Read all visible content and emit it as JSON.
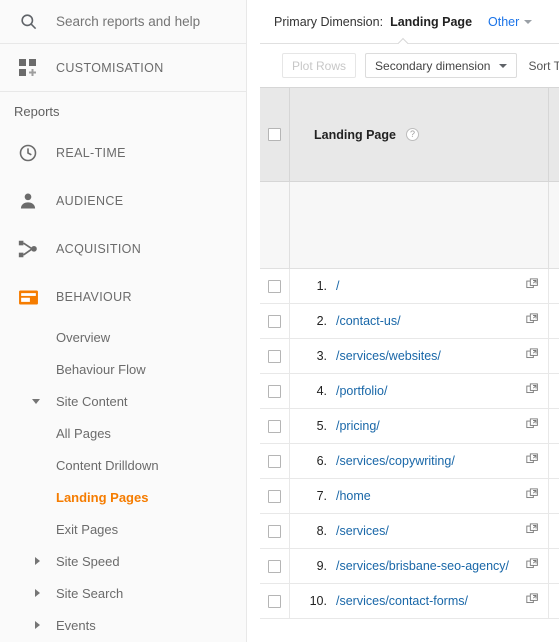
{
  "sidebar": {
    "search": {
      "placeholder": "Search reports and help",
      "value": "",
      "icon": "search-icon"
    },
    "customisation": {
      "label": "CUSTOMISATION",
      "icon": "customisation-icon"
    },
    "reports_heading": "Reports",
    "sections": [
      {
        "label": "REAL-TIME",
        "icon": "clock-icon",
        "active": false
      },
      {
        "label": "AUDIENCE",
        "icon": "person-icon",
        "active": false
      },
      {
        "label": "ACQUISITION",
        "icon": "acquisition-icon",
        "active": false
      },
      {
        "label": "BEHAVIOUR",
        "icon": "behaviour-icon",
        "active": true
      }
    ],
    "behaviour_items": [
      {
        "label": "Overview",
        "arrow": "none",
        "selected": false
      },
      {
        "label": "Behaviour Flow",
        "arrow": "none",
        "selected": false
      },
      {
        "label": "Site Content",
        "arrow": "down",
        "selected": false
      },
      {
        "label": "All Pages",
        "arrow": "none",
        "selected": false
      },
      {
        "label": "Content Drilldown",
        "arrow": "none",
        "selected": false
      },
      {
        "label": "Landing Pages",
        "arrow": "none",
        "selected": true
      },
      {
        "label": "Exit Pages",
        "arrow": "none",
        "selected": false
      },
      {
        "label": "Site Speed",
        "arrow": "right",
        "selected": false
      },
      {
        "label": "Site Search",
        "arrow": "right",
        "selected": false
      },
      {
        "label": "Events",
        "arrow": "right",
        "selected": false
      }
    ]
  },
  "content": {
    "primary_dimension": {
      "label": "Primary Dimension:",
      "value": "Landing Page",
      "other_label": "Other"
    },
    "controls": {
      "plot_rows_label": "Plot Rows",
      "secondary_dimension_label": "Secondary dimension",
      "sort_type_label": "Sort Type:"
    },
    "table": {
      "header": {
        "column_label": "Landing Page",
        "help_icon": "help-icon"
      },
      "rows": [
        {
          "index": "1.",
          "path": "/"
        },
        {
          "index": "2.",
          "path": "/contact-us/"
        },
        {
          "index": "3.",
          "path": "/services/websites/"
        },
        {
          "index": "4.",
          "path": "/portfolio/"
        },
        {
          "index": "5.",
          "path": "/pricing/"
        },
        {
          "index": "6.",
          "path": "/services/copywriting/"
        },
        {
          "index": "7.",
          "path": "/home"
        },
        {
          "index": "8.",
          "path": "/services/"
        },
        {
          "index": "9.",
          "path": "/services/brisbane-seo-agency/"
        },
        {
          "index": "10.",
          "path": "/services/contact-forms/"
        }
      ]
    }
  },
  "colors": {
    "accent_orange": "#f57c00",
    "link_blue": "#1967a8",
    "other_link_blue": "#1a73e8",
    "sidebar_bg": "#fafafa",
    "table_header_bg": "#e8e8e8"
  }
}
